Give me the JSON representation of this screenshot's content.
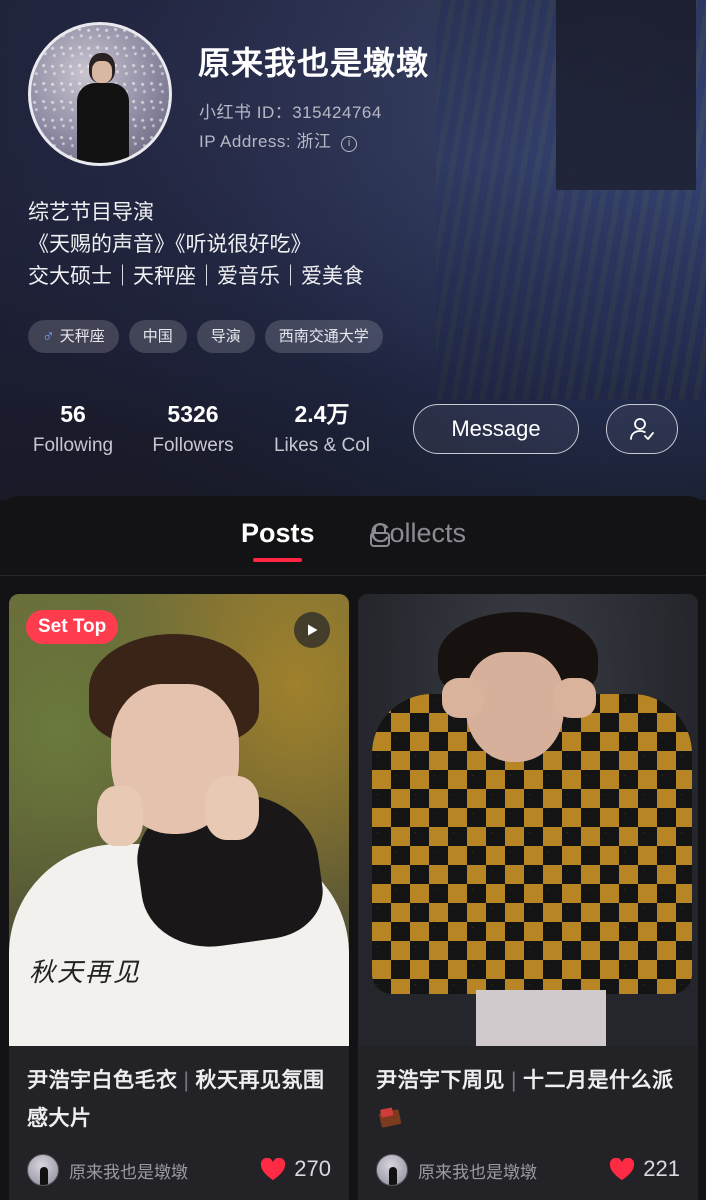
{
  "profile": {
    "username": "原来我也是墩墩",
    "xhs_id": "小红书 ID：315424764",
    "ip_address": "IP Address: 浙江",
    "bio": [
      "综艺节目导演",
      "《天赐的声音》《听说很好吃》",
      "交大硕士｜天秤座｜爱音乐｜爱美食"
    ],
    "tags": [
      "天秤座",
      "中国",
      "导演",
      "西南交通大学"
    ],
    "stats": {
      "following": {
        "value": "56",
        "label": "Following"
      },
      "followers": {
        "value": "5326",
        "label": "Followers"
      },
      "likes": {
        "value": "2.4万",
        "label": "Likes & Col"
      }
    },
    "message_label": "Message"
  },
  "tabs": {
    "posts": "Posts",
    "collects": "Collects"
  },
  "posts": [
    {
      "badge": "Set Top",
      "overlay_text": "秋天再见",
      "title_a": "尹浩宇白色毛衣",
      "title_b": "秋天再见氛围感大片",
      "author": "原来我也是墩墩",
      "likes": "270"
    },
    {
      "title_a": "尹浩宇下周见",
      "title_b": "十二月是什么派",
      "author": "原来我也是墩墩",
      "likes": "221"
    }
  ],
  "colors": {
    "accent": "#ff2442",
    "badge": "#ff3b4e",
    "heart": "#ff2a44",
    "male": "#6aa8ff"
  }
}
